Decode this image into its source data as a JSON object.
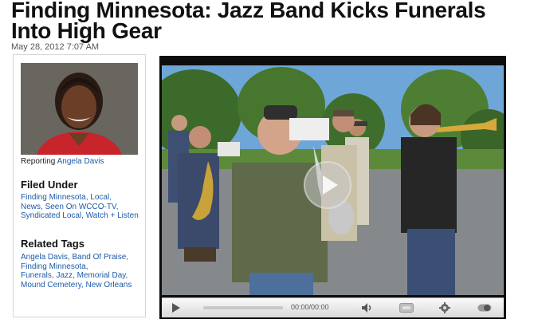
{
  "article": {
    "headline": "Finding Minnesota: Jazz Band Kicks Funerals Into High Gear",
    "date": "May 28, 2012 7:07 AM"
  },
  "sidebar": {
    "reporting_label": "Reporting",
    "reporter_name": "Angela Davis",
    "filed_under_heading": "Filed Under",
    "filed_under_links": [
      "Finding Minnesota",
      "Local",
      "News",
      "Seen On WCCO-TV",
      "Syndicated Local",
      "Watch + Listen"
    ],
    "related_tags_heading": "Related Tags",
    "related_tags_links": [
      "Angela Davis",
      "Band Of Praise",
      "Finding Minnesota",
      "Funerals",
      "Jazz",
      "Memorial Day",
      "Mound Cemetery",
      "New Orleans"
    ]
  },
  "video_player": {
    "time_display": "00:00/00:00",
    "icons": {
      "play": "play-icon",
      "volume": "volume-icon",
      "caption": "cc-icon",
      "settings": "gear-icon",
      "toggle": "toggle-icon"
    }
  },
  "colors": {
    "link": "#1d5aa8",
    "headline": "#111111"
  }
}
